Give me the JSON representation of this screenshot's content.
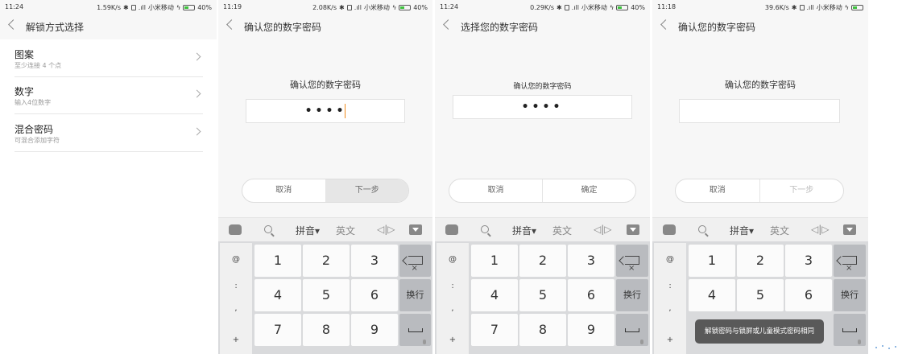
{
  "screens": [
    {
      "status": {
        "time": "11:24",
        "speed": "1.59K/s",
        "carrier": "小米移动",
        "battery": "40%"
      },
      "title": "解锁方式选择",
      "items": [
        {
          "title": "图案",
          "subtitle": "至少连接 4 个点"
        },
        {
          "title": "数字",
          "subtitle": "输入4位数字"
        },
        {
          "title": "混合密码",
          "subtitle": "可混合添加字符"
        }
      ]
    },
    {
      "status": {
        "time": "11:19",
        "speed": "2.08K/s",
        "carrier": "小米移动",
        "battery": "40%"
      },
      "title": "确认您的数字密码",
      "prompt": "确认您的数字密码",
      "pin": "••••",
      "left_button": "取消",
      "right_button": "下一步"
    },
    {
      "status": {
        "time": "11:24",
        "speed": "0.29K/s",
        "carrier": "小米移动",
        "battery": "40%"
      },
      "title": "选择您的数字密码",
      "prompt": "确认您的数字密码",
      "pin": "••••",
      "left_button": "取消",
      "right_button": "确定"
    },
    {
      "status": {
        "time": "11:18",
        "speed": "39.6K/s",
        "carrier": "小米移动",
        "battery": "40%"
      },
      "title": "确认您的数字密码",
      "prompt": "确认您的数字密码",
      "pin": "",
      "left_button": "取消",
      "right_button": "下一步",
      "toast": "解锁密码与锁屏或儿童模式密码相同"
    }
  ],
  "keyboard": {
    "pinyin_label": "拼音",
    "english_label": "英文",
    "symbols": [
      "@",
      ":",
      ",",
      "+"
    ],
    "digits": [
      "1",
      "2",
      "3",
      "4",
      "5",
      "6",
      "7",
      "8",
      "9"
    ],
    "newline_label": "换行"
  },
  "colors": {
    "accent_caret": "#f08a1c",
    "battery_green": "#3ec13e",
    "toast_bg": "#595959"
  }
}
